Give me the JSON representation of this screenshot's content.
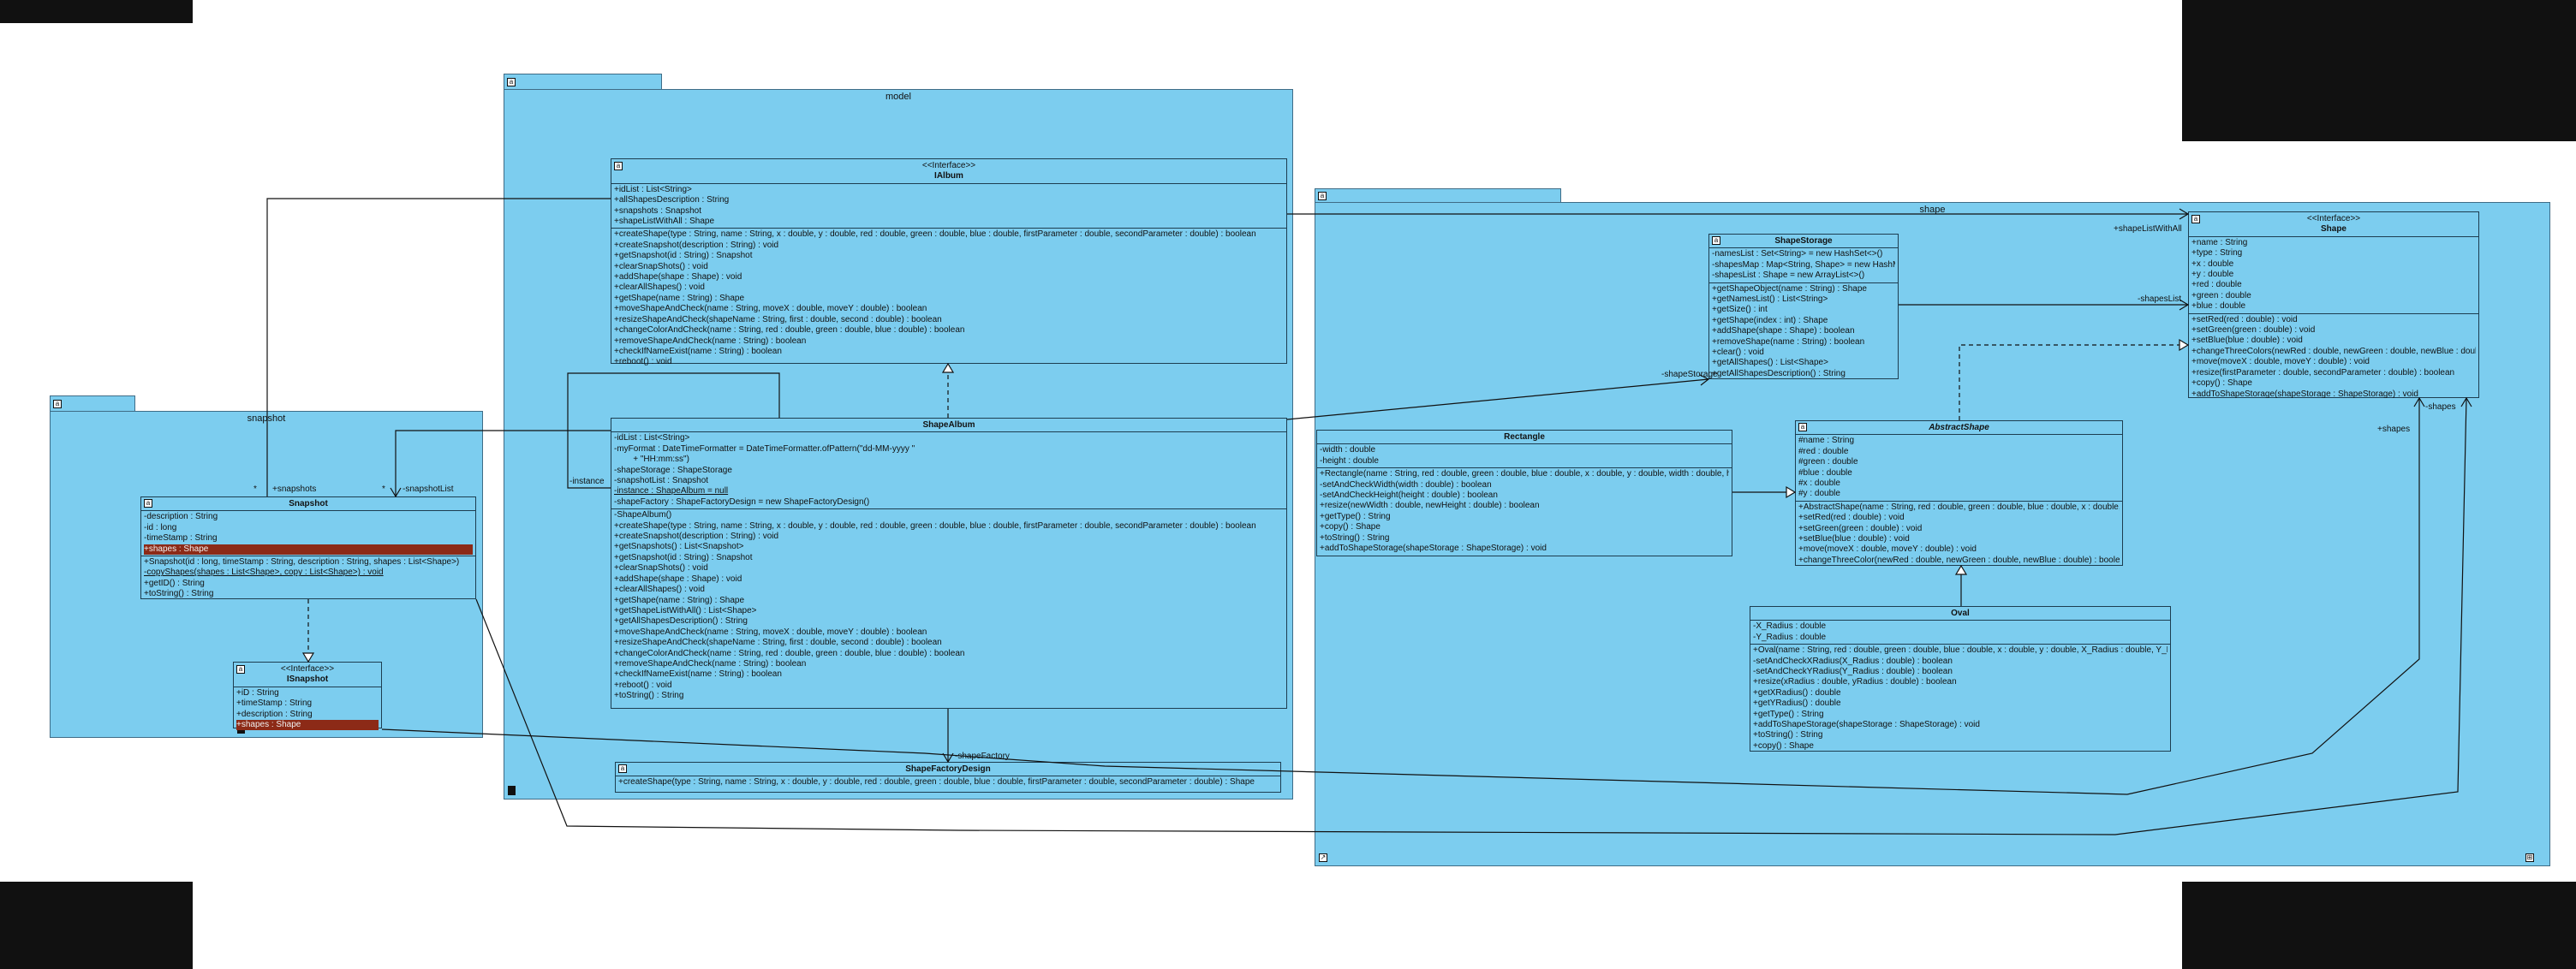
{
  "diagram": {
    "packages": [
      {
        "id": "model",
        "title": "model"
      },
      {
        "id": "snapshot",
        "title": "snapshot"
      },
      {
        "id": "shape",
        "title": "shape"
      }
    ],
    "classes": [
      {
        "id": "ialbum",
        "stereotype": "<<Interface>>",
        "name": "IAlbum",
        "attributes": [
          "+idList : List<String>",
          "+allShapesDescription : String",
          "+snapshots : Snapshot",
          "+shapeListWithAll : Shape"
        ],
        "operations": [
          "+createShape(type : String, name : String, x : double, y : double, red : double, green : double, blue : double, firstParameter : double, secondParameter : double) : boolean",
          "+createSnapshot(description : String) : void",
          "+getSnapshot(id : String) : Snapshot",
          "+clearSnapShots() : void",
          "+addShape(shape : Shape) : void",
          "+clearAllShapes() : void",
          "+getShape(name : String) : Shape",
          "+moveShapeAndCheck(name : String, moveX : double, moveY : double) : boolean",
          "+resizeShapeAndCheck(shapeName : String, first : double, second : double) : boolean",
          "+changeColorAndCheck(name : String, red : double, green : double, blue : double) : boolean",
          "+removeShapeAndCheck(name : String) : boolean",
          "+checkIfNameExist(name : String) : boolean",
          "+reboot() : void"
        ]
      },
      {
        "id": "shapealbum",
        "stereotype": "",
        "name": "ShapeAlbum",
        "attributes": [
          "-idList : List<String>",
          "-myFormat : DateTimeFormatter = DateTimeFormatter.ofPattern(\"dd-MM-yyyy \"",
          "        + \"HH:mm:ss\")",
          "-shapeStorage : ShapeStorage",
          "-snapshotList : Snapshot",
          "-instance : ShapeAlbum = null",
          "-shapeFactory : ShapeFactoryDesign = new ShapeFactoryDesign()"
        ],
        "operations": [
          "-ShapeAlbum()",
          "+createShape(type : String, name : String, x : double, y : double, red : double, green : double, blue : double, firstParameter : double, secondParameter : double) : boolean",
          "+createSnapshot(description : String) : void",
          "+getSnapshots() : List<Snapshot>",
          "+getSnapshot(id : String) : Snapshot",
          "+clearSnapShots() : void",
          "+addShape(shape : Shape) : void",
          "+clearAllShapes() : void",
          "+getShape(name : String) : Shape",
          "+getShapeListWithAll() : List<Shape>",
          "+getAllShapesDescription() : String",
          "+moveShapeAndCheck(name : String, moveX : double, moveY : double) : boolean",
          "+resizeShapeAndCheck(shapeName : String, first : double, second : double) : boolean",
          "+changeColorAndCheck(name : String, red : double, green : double, blue : double) : boolean",
          "+removeShapeAndCheck(name : String) : boolean",
          "+checkIfNameExist(name : String) : boolean",
          "+reboot() : void",
          "+toString() : String"
        ]
      },
      {
        "id": "factory",
        "stereotype": "",
        "name": "ShapeFactoryDesign",
        "attributes": [],
        "operations": [
          "+createShape(type : String, name : String, x : double, y : double, red : double, green : double, blue : double, firstParameter : double, secondParameter : double) : Shape"
        ]
      },
      {
        "id": "snapshotcls",
        "stereotype": "",
        "name": "Snapshot",
        "attributes": [
          "-description : String",
          "-id : long",
          "-timeStamp : String",
          "+shapes : Shape"
        ],
        "operations": [
          "+Snapshot(id : long, timeStamp : String, description : String, shapes : List<Shape>)",
          "-copyShapes(shapes : List<Shape>, copy : List<Shape>) : void",
          "+getID() : String",
          "+toString() : String"
        ]
      },
      {
        "id": "isnapshot",
        "stereotype": "<<Interface>>",
        "name": "ISnapshot",
        "attributes": [
          "+iD : String",
          "+timeStamp : String",
          "+description : String",
          "+shapes : Shape"
        ],
        "operations": []
      },
      {
        "id": "shapestorage",
        "stereotype": "",
        "name": "ShapeStorage",
        "attributes": [
          "-namesList : Set<String> = new HashSet<>()",
          "-shapesMap : Map<String, Shape> = new HashMap<>()",
          "-shapesList : Shape = new ArrayList<>()"
        ],
        "operations": [
          "+getShapeObject(name : String) : Shape",
          "+getNamesList() : List<String>",
          "+getSize() : int",
          "+getShape(index : int) : Shape",
          "+addShape(shape : Shape) : boolean",
          "+removeShape(name : String) : boolean",
          "+clear() : void",
          "+getAllShapes() : List<Shape>",
          "+getAllShapesDescription() : String"
        ]
      },
      {
        "id": "ishape",
        "stereotype": "<<Interface>>",
        "name": "Shape",
        "attributes": [
          "+name : String",
          "+type : String",
          "+x : double",
          "+y : double",
          "+red : double",
          "+green : double",
          "+blue : double"
        ],
        "operations": [
          "+setRed(red : double) : void",
          "+setGreen(green : double) : void",
          "+setBlue(blue : double) : void",
          "+changeThreeColors(newRed : double, newGreen : double, newBlue : double) : boolean",
          "+move(moveX : double, moveY : double) : void",
          "+resize(firstParameter : double, secondParameter : double) : boolean",
          "+copy() : Shape",
          "+addToShapeStorage(shapeStorage : ShapeStorage) : void"
        ]
      },
      {
        "id": "rectangle",
        "stereotype": "",
        "name": "Rectangle",
        "attributes": [
          "-width : double",
          "-height : double"
        ],
        "operations": [
          "+Rectangle(name : String, red : double, green : double, blue : double, x : double, y : double, width : double, height : double)",
          "-setAndCheckWidth(width : double) : boolean",
          "-setAndCheckHeight(height : double) : boolean",
          "+resize(newWidth : double, newHeight : double) : boolean",
          "+getType() : String",
          "+copy() : Shape",
          "+toString() : String",
          "+addToShapeStorage(shapeStorage : ShapeStorage) : void"
        ]
      },
      {
        "id": "abstractshape",
        "stereotype": "",
        "name": "AbstractShape",
        "attributes": [
          "#name : String",
          "#red : double",
          "#green : double",
          "#blue : double",
          "#x : double",
          "#y : double"
        ],
        "operations": [
          "+AbstractShape(name : String, red : double, green : double, blue : double, x : double, y : double)",
          "+setRed(red : double) : void",
          "+setGreen(green : double) : void",
          "+setBlue(blue : double) : void",
          "+move(moveX : double, moveY : double) : void",
          "+changeThreeColor(newRed : double, newGreen : double, newBlue : double) : boolean"
        ]
      },
      {
        "id": "oval",
        "stereotype": "",
        "name": "Oval",
        "attributes": [
          "-X_Radius : double",
          "-Y_Radius : double"
        ],
        "operations": [
          "+Oval(name : String, red : double, green : double, blue : double, x : double, y : double, X_Radius : double, Y_Radius : double)",
          "-setAndCheckXRadius(X_Radius : double) : boolean",
          "-setAndCheckYRadius(Y_Radius : double) : boolean",
          "+resize(xRadius : double, yRadius : double) : boolean",
          "+getXRadius() : double",
          "+getYRadius() : double",
          "+getType() : String",
          "+addToShapeStorage(shapeStorage : ShapeStorage) : void",
          "+toString() : String",
          "+copy() : Shape"
        ]
      }
    ],
    "labels": {
      "snapshots": "+snapshots",
      "snapshotList": "-snapshotList",
      "star1": "*",
      "star2": "*",
      "instance": "-instance",
      "shapeFactory": "-shapeFactory",
      "shapeStorage": "-shapeStorage",
      "shapesList": "-shapesList",
      "shapeListWithAll": "+shapeListWithAll",
      "shapes1": "+shapes",
      "shapes2": "-shapes"
    }
  }
}
